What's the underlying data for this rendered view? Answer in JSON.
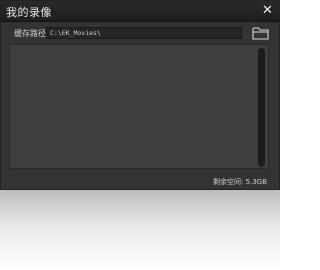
{
  "window": {
    "title": "我的录像",
    "close_glyph": "✕"
  },
  "path": {
    "label": "缓存路径",
    "value": "C:\\EK_Movies\\"
  },
  "status": {
    "free_space_label": "剩余空间:",
    "free_space_value": "5.3GB"
  },
  "icons": {
    "close": "close-icon",
    "folder": "folder-icon"
  },
  "colors": {
    "window_bg": "#333333",
    "titlebar_bg": "#1e1e1e",
    "list_bg": "#3e3e3e",
    "text": "#e6e6e6"
  }
}
